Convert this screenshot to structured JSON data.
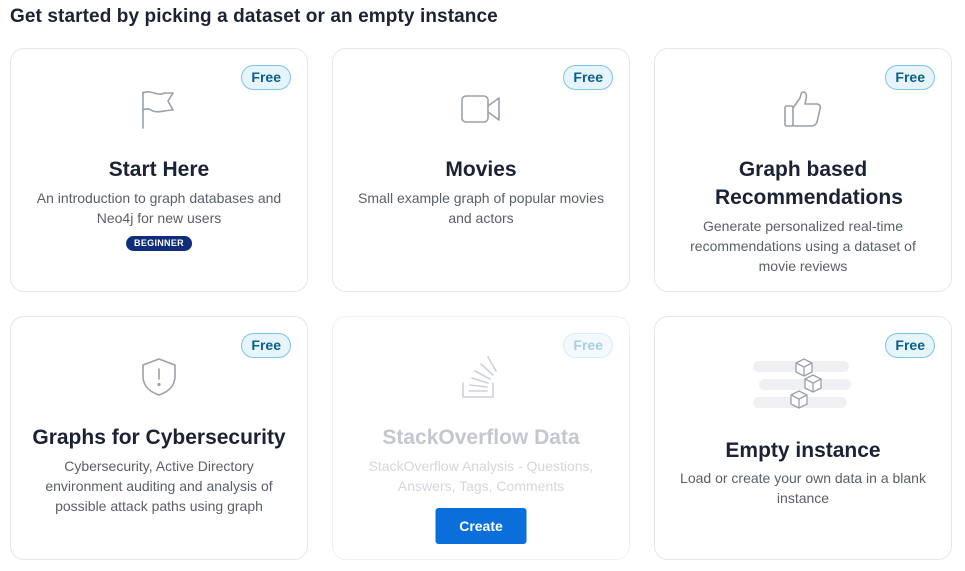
{
  "heading": "Get started by picking a dataset or an empty instance",
  "cards": [
    {
      "title": "Start Here",
      "description": "An introduction to graph databases and Neo4j for new users",
      "badge": "Free",
      "tag": "BEGINNER",
      "icon": "flag-icon"
    },
    {
      "title": "Movies",
      "description": "Small example graph of popular movies and actors",
      "badge": "Free",
      "icon": "video-camera-icon"
    },
    {
      "title": "Graph based Recommendations",
      "description": "Generate personalized real-time recommendations using a dataset of movie reviews",
      "badge": "Free",
      "icon": "thumbs-up-icon"
    },
    {
      "title": "Graphs for Cybersecurity",
      "description": "Cybersecurity, Active Directory environment auditing and analysis of possible attack paths using graph",
      "badge": "Free",
      "icon": "shield-alert-icon"
    },
    {
      "title": "StackOverflow Data",
      "description": "StackOverflow Analysis - Questions, Answers, Tags, Comments",
      "badge": "Free",
      "button": "Create",
      "icon": "stack-overflow-icon"
    },
    {
      "title": "Empty instance",
      "description": "Load or create your own data in a blank instance",
      "badge": "Free",
      "icon": "cubes-icon"
    }
  ]
}
